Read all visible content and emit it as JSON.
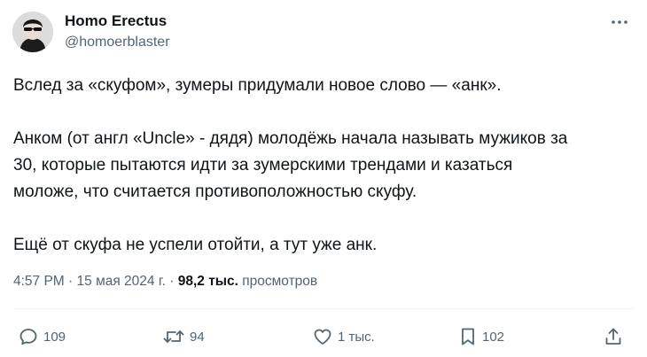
{
  "author": {
    "name": "Homo Erectus",
    "handle": "@homoerblaster"
  },
  "more_icon": "more-horizontal-icon",
  "body": {
    "line1": "Вслед за «скуфом», зумеры придумали новое слово — «анк».",
    "line2": "Анком (от англ «Uncle» - дядя) молодёжь начала называть мужиков за",
    "line3": "30, которые пытаются идти за зумерскими трендами и казаться",
    "line4": "моложе, что считается противоположностью скуфу.",
    "line5": "Ещё от скуфа не успели отойти, а тут уже анк."
  },
  "meta": {
    "time": "4:57 PM",
    "separator1": "·",
    "date": "15 мая 2024 г.",
    "separator2": "·",
    "views_count": "98,2 тыс.",
    "views_label": "просмотров"
  },
  "actions": {
    "replies": "109",
    "reposts": "94",
    "likes": "1 тыс.",
    "bookmarks": "102"
  },
  "colors": {
    "text": "#0f1419",
    "secondary": "#536471",
    "divider": "#eff3f4"
  }
}
